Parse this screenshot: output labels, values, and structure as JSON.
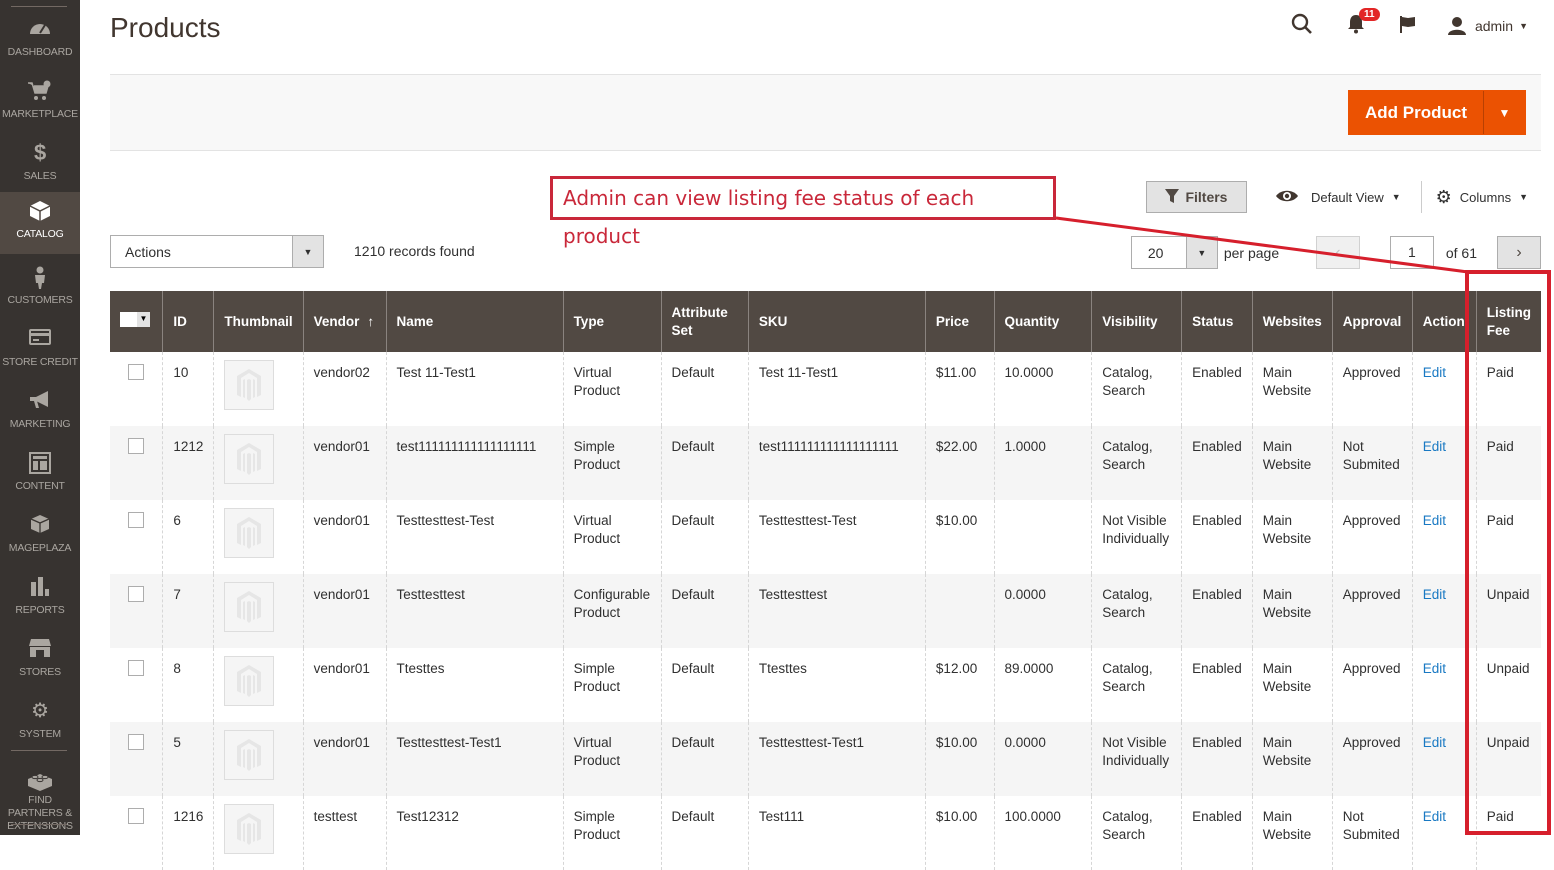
{
  "sidebar": {
    "items": [
      {
        "label": "DASHBOARD",
        "icon": "dashboard-icon",
        "glyph": "◔",
        "active": false
      },
      {
        "label": "MARKETPLACE",
        "icon": "cart-gear-icon",
        "glyph": "🛒",
        "active": false
      },
      {
        "label": "SALES",
        "icon": "dollar-icon",
        "glyph": "$",
        "active": false
      },
      {
        "label": "CATALOG",
        "icon": "box-icon",
        "glyph": "❒",
        "active": true
      },
      {
        "label": "CUSTOMERS",
        "icon": "person-icon",
        "glyph": "♟",
        "active": false
      },
      {
        "label": "STORE CREDIT",
        "icon": "credit-card-icon",
        "glyph": "▭",
        "active": false
      },
      {
        "label": "MARKETING",
        "icon": "megaphone-icon",
        "glyph": "📢",
        "active": false
      },
      {
        "label": "CONTENT",
        "icon": "layout-icon",
        "glyph": "▦",
        "active": false
      },
      {
        "label": "MAGEPLAZA",
        "icon": "cube-icon",
        "glyph": "⬢",
        "active": false
      },
      {
        "label": "REPORTS",
        "icon": "bar-chart-icon",
        "glyph": "▮",
        "active": false
      },
      {
        "label": "STORES",
        "icon": "storefront-icon",
        "glyph": "⌂",
        "active": false
      },
      {
        "label": "SYSTEM",
        "icon": "gear-icon",
        "glyph": "⚙",
        "active": false
      },
      {
        "label": "FIND PARTNERS & EXTENSIONS",
        "icon": "lego-brick-icon",
        "glyph": "▣",
        "active": false
      }
    ]
  },
  "header": {
    "title": "Products",
    "notifications_count": "11",
    "user": "admin"
  },
  "page_actions": {
    "add_product": "Add Product"
  },
  "annotation": {
    "text": "Admin can view listing fee status of each product",
    "color": "#c9283a"
  },
  "toolbar": {
    "filters": "Filters",
    "view": "Default View",
    "columns": "Columns",
    "actions": "Actions",
    "records_found": "1210 records found",
    "per_page_value": "20",
    "per_page_label": "per page",
    "current_page": "1",
    "of_pages": "of 61"
  },
  "grid": {
    "columns": [
      "ID",
      "Thumbnail",
      "Vendor",
      "Name",
      "Type",
      "Attribute Set",
      "SKU",
      "Price",
      "Quantity",
      "Visibility",
      "Status",
      "Websites",
      "Approval",
      "Action",
      "Listing Fee"
    ],
    "sorted_column": "Vendor",
    "sort_direction": "ascending",
    "rows": [
      {
        "id": "10",
        "vendor": "vendor02",
        "name": "Test 11-Test1",
        "type": "Virtual Product",
        "attribute_set": "Default",
        "sku": "Test 11-Test1",
        "price": "$11.00",
        "quantity": "10.0000",
        "visibility": "Catalog, Search",
        "status": "Enabled",
        "websites": "Main Website",
        "approval": "Approved",
        "action": "Edit",
        "listing_fee": "Paid"
      },
      {
        "id": "1212",
        "vendor": "vendor01",
        "name": "test111111111111111111",
        "type": "Simple Product",
        "attribute_set": "Default",
        "sku": "test111111111111111111",
        "price": "$22.00",
        "quantity": "1.0000",
        "visibility": "Catalog, Search",
        "status": "Enabled",
        "websites": "Main Website",
        "approval": "Not Submited",
        "action": "Edit",
        "listing_fee": "Paid"
      },
      {
        "id": "6",
        "vendor": "vendor01",
        "name": "Testtesttest-Test",
        "type": "Virtual Product",
        "attribute_set": "Default",
        "sku": "Testtesttest-Test",
        "price": "$10.00",
        "quantity": "",
        "visibility": "Not Visible Individually",
        "status": "Enabled",
        "websites": "Main Website",
        "approval": "Approved",
        "action": "Edit",
        "listing_fee": "Paid"
      },
      {
        "id": "7",
        "vendor": "vendor01",
        "name": "Testtesttest",
        "type": "Configurable Product",
        "attribute_set": "Default",
        "sku": "Testtesttest",
        "price": "",
        "quantity": "0.0000",
        "visibility": "Catalog, Search",
        "status": "Enabled",
        "websites": "Main Website",
        "approval": "Approved",
        "action": "Edit",
        "listing_fee": "Unpaid"
      },
      {
        "id": "8",
        "vendor": "vendor01",
        "name": "Ttesttes",
        "type": "Simple Product",
        "attribute_set": "Default",
        "sku": "Ttesttes",
        "price": "$12.00",
        "quantity": "89.0000",
        "visibility": "Catalog, Search",
        "status": "Enabled",
        "websites": "Main Website",
        "approval": "Approved",
        "action": "Edit",
        "listing_fee": "Unpaid"
      },
      {
        "id": "5",
        "vendor": "vendor01",
        "name": "Testtesttest-Test1",
        "type": "Virtual Product",
        "attribute_set": "Default",
        "sku": "Testtesttest-Test1",
        "price": "$10.00",
        "quantity": "0.0000",
        "visibility": "Not Visible Individually",
        "status": "Enabled",
        "websites": "Main Website",
        "approval": "Approved",
        "action": "Edit",
        "listing_fee": "Unpaid"
      },
      {
        "id": "1216",
        "vendor": "testtest",
        "name": "Test12312",
        "type": "Simple Product",
        "attribute_set": "Default",
        "sku": "Test111",
        "price": "$10.00",
        "quantity": "100.0000",
        "visibility": "Catalog, Search",
        "status": "Enabled",
        "websites": "Main Website",
        "approval": "Not Submited",
        "action": "Edit",
        "listing_fee": "Paid"
      }
    ]
  },
  "colors": {
    "sidebar_bg": "#373330",
    "header_row_bg": "#514943",
    "accent_orange": "#eb5202",
    "link_blue": "#1979c3",
    "annotation_red": "#d61f2c"
  }
}
